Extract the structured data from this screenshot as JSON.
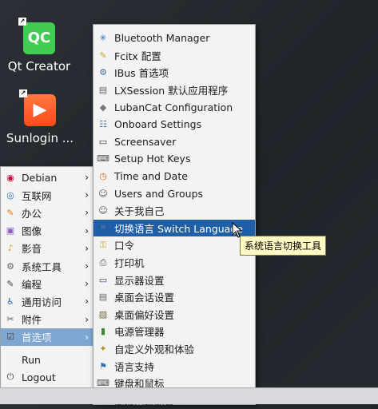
{
  "desktop": {
    "icons": [
      {
        "label": "Qt Creator",
        "glyph": "QC",
        "icon": "qt-creator-icon"
      },
      {
        "label": "Sunlogin ...",
        "glyph": "▶",
        "icon": "sunlogin-icon"
      }
    ]
  },
  "main_menu": {
    "items": [
      {
        "label": "Debian",
        "icon": "debian-icon",
        "glyph": "◉",
        "color": "#c70036"
      },
      {
        "label": "互联网",
        "icon": "internet-icon",
        "glyph": "◎",
        "color": "#2a6fbf"
      },
      {
        "label": "办公",
        "icon": "office-icon",
        "glyph": "✎",
        "color": "#e07a1a"
      },
      {
        "label": "图像",
        "icon": "graphics-icon",
        "glyph": "▣",
        "color": "#8a5cc0"
      },
      {
        "label": "影音",
        "icon": "media-icon",
        "glyph": "♪",
        "color": "#d4a017"
      },
      {
        "label": "系统工具",
        "icon": "system-tools-icon",
        "glyph": "⚙",
        "color": "#666"
      },
      {
        "label": "编程",
        "icon": "programming-icon",
        "glyph": "✎",
        "color": "#444"
      },
      {
        "label": "通用访问",
        "icon": "accessibility-icon",
        "glyph": "♿",
        "color": "#2a6fbf"
      },
      {
        "label": "附件",
        "icon": "accessories-icon",
        "glyph": "✂",
        "color": "#555"
      },
      {
        "label": "首选项",
        "icon": "preferences-icon",
        "glyph": "☑",
        "color": "#444"
      },
      {
        "label": "Run",
        "icon": "run-icon",
        "glyph": "",
        "color": "#555"
      },
      {
        "label": "Logout",
        "icon": "logout-icon",
        "glyph": "⏻",
        "color": "#444"
      }
    ]
  },
  "submenu": {
    "items": [
      {
        "label": "Bluetooth Manager",
        "icon": "bluetooth-icon",
        "glyph": "✳",
        "color": "#2a6fbf"
      },
      {
        "label": "Fcitx 配置",
        "icon": "fcitx-icon",
        "glyph": "✎",
        "color": "#c9a227"
      },
      {
        "label": "IBus 首选项",
        "icon": "ibus-icon",
        "glyph": "⚙",
        "color": "#3a6ea5"
      },
      {
        "label": "LXSession 默认应用程序",
        "icon": "lxsession-icon",
        "glyph": "▤",
        "color": "#666"
      },
      {
        "label": "LubanCat Configuration",
        "icon": "lubancat-icon",
        "glyph": "◆",
        "color": "#777"
      },
      {
        "label": "Onboard Settings",
        "icon": "onboard-icon",
        "glyph": "☷",
        "color": "#3a6ea5"
      },
      {
        "label": "Screensaver",
        "icon": "screensaver-icon",
        "glyph": "▭",
        "color": "#333"
      },
      {
        "label": "Setup Hot Keys",
        "icon": "hotkeys-icon",
        "glyph": "⌨",
        "color": "#555"
      },
      {
        "label": "Time and Date",
        "icon": "clock-icon",
        "glyph": "◷",
        "color": "#c9701a"
      },
      {
        "label": "Users and Groups",
        "icon": "users-icon",
        "glyph": "☺",
        "color": "#555"
      },
      {
        "label": "关于我自己",
        "icon": "about-me-icon",
        "glyph": "☺",
        "color": "#555"
      },
      {
        "label": "切换语言 Switch Language",
        "icon": "language-icon",
        "glyph": "⚑",
        "color": "#3a6ea5"
      },
      {
        "label": "口令",
        "icon": "password-icon",
        "glyph": "⚿",
        "color": "#c9a227"
      },
      {
        "label": "打印机",
        "icon": "printer-icon",
        "glyph": "⎙",
        "color": "#555"
      },
      {
        "label": "显示器设置",
        "icon": "display-icon",
        "glyph": "▭",
        "color": "#2a4a7a"
      },
      {
        "label": "桌面会话设置",
        "icon": "session-icon",
        "glyph": "▤",
        "color": "#666"
      },
      {
        "label": "桌面偏好设置",
        "icon": "desktop-prefs-icon",
        "glyph": "▨",
        "color": "#7a6a3a"
      },
      {
        "label": "电源管理器",
        "icon": "power-icon",
        "glyph": "▮",
        "color": "#3a8a3a"
      },
      {
        "label": "自定义外观和体验",
        "icon": "appearance-icon",
        "glyph": "✦",
        "color": "#b0902a"
      },
      {
        "label": "语言支持",
        "icon": "language-support-icon",
        "glyph": "⚑",
        "color": "#3a6ea5"
      },
      {
        "label": "键盘和鼠标",
        "icon": "keyboard-mouse-icon",
        "glyph": "⌨",
        "color": "#555"
      },
      {
        "label": "高级网络配置",
        "icon": "network-icon",
        "glyph": "≡",
        "color": "#555"
      }
    ]
  },
  "tooltip": {
    "text": "系统语言切换工具"
  }
}
